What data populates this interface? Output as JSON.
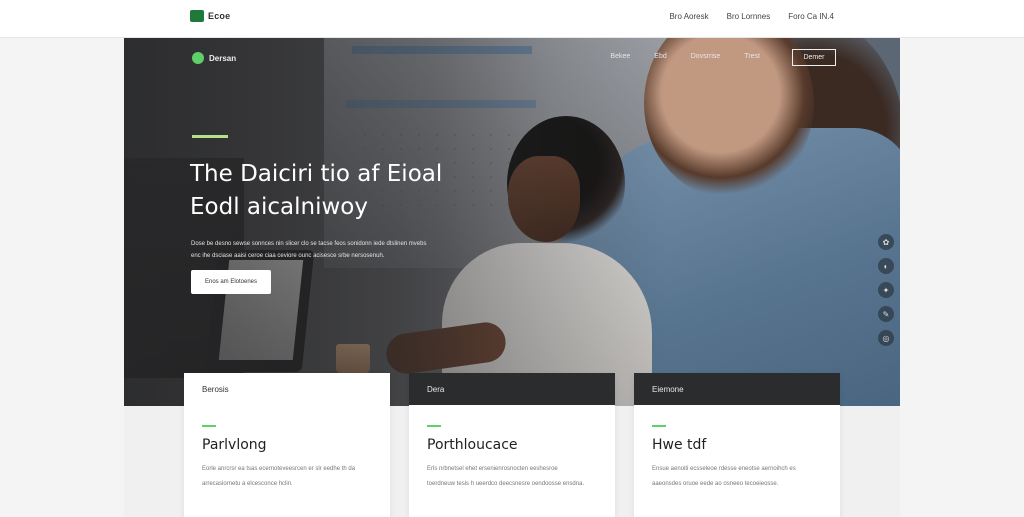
{
  "topbar": {
    "logo_text": "Ecoe",
    "links": [
      "Bro Aoresk",
      "Bro Lornnes",
      "Foro Ca  IN.4"
    ]
  },
  "hero": {
    "logo_text": "Dersan",
    "nav": [
      "Bekee",
      "Ebd",
      "Dovsrrise",
      "Trest"
    ],
    "cta_label": "Demer",
    "title_line1": "The Daiciri tio af Eioal",
    "title_line2": "Eodl aicalniwoy",
    "description_line1": "Dose be desno sewse sonnces nin slicer clo se tacse feos sonidonn iede dtslinen mvebs",
    "description_line2": "enc ihe dsciase aaisi ceroe ciaa ceviore ounc acisesce srbe nersosenuh.",
    "button_label": "Enos am Elotoenes",
    "social_icons": [
      "share-icon",
      "info-icon",
      "link-icon",
      "edit-icon",
      "globe-icon"
    ],
    "social_glyphs": [
      "✿",
      "◐",
      "✦",
      "✎",
      "◎"
    ]
  },
  "cards": [
    {
      "header": "Berosis",
      "style": "light",
      "title": "Parlvlong",
      "text": "Eorle anrcrsr ea tsas ecernoteveesrcen er slr eedhe th da arrecaslornetu a elcesconce hclin."
    },
    {
      "header": "Dera",
      "style": "dark",
      "title": "Porthloucace",
      "text": "Erls nrbnetsel ehet ersenienrosnocten eeshesroe toerdneuw tesis h ueerdco deecsnesre oendoosse ensdna."
    },
    {
      "header": "Eiemone",
      "style": "dark",
      "title": "Hwe tdf",
      "text": "Ensue aenoiti ecsseleoe rdesse eneotse aernoihch es aaeonsdes oruoe eede ao osneeo tecoeieosse."
    }
  ],
  "colors": {
    "accent_green": "#5fcf6a",
    "accent_lime": "#b7e08a",
    "logo_green": "#1f7a3a"
  }
}
